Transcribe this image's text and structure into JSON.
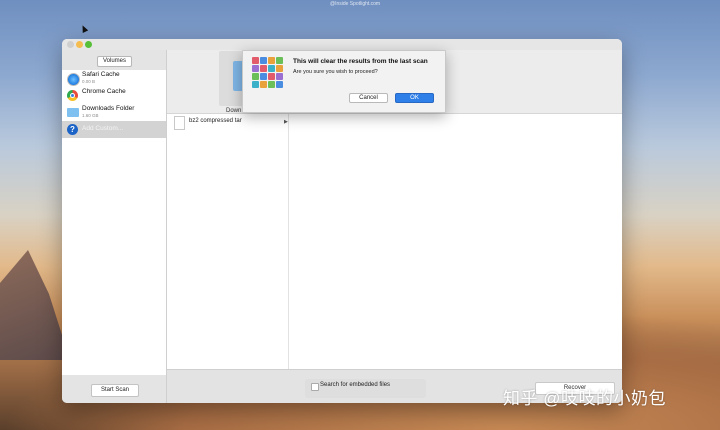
{
  "desktop": {
    "top_label": "@Inside Spotlight.com",
    "watermark": "知乎 @吱吱的小奶包"
  },
  "window": {
    "sidebar": {
      "tab_label": "Volumes",
      "items": [
        {
          "name": "Safari Cache",
          "sub": "0.00 B",
          "icon": "safari-icon"
        },
        {
          "name": "Chrome Cache",
          "sub": "",
          "icon": "chrome-icon"
        },
        {
          "name": "Downloads Folder",
          "sub": "1.60 GB",
          "icon": "folder-icon"
        },
        {
          "name": "Add Custom...",
          "sub": "",
          "icon": "help-icon"
        }
      ],
      "start_scan": "Start Scan"
    },
    "main": {
      "folder_label": "Down",
      "file_item": "bz2 compressed tar",
      "embed_label": "Search for embedded files",
      "recover_label": "Recover"
    }
  },
  "dialog": {
    "title": "This will clear the results from the last scan",
    "message": "Are you sure you wish to proceed?",
    "cancel": "Cancel",
    "ok": "OK"
  }
}
